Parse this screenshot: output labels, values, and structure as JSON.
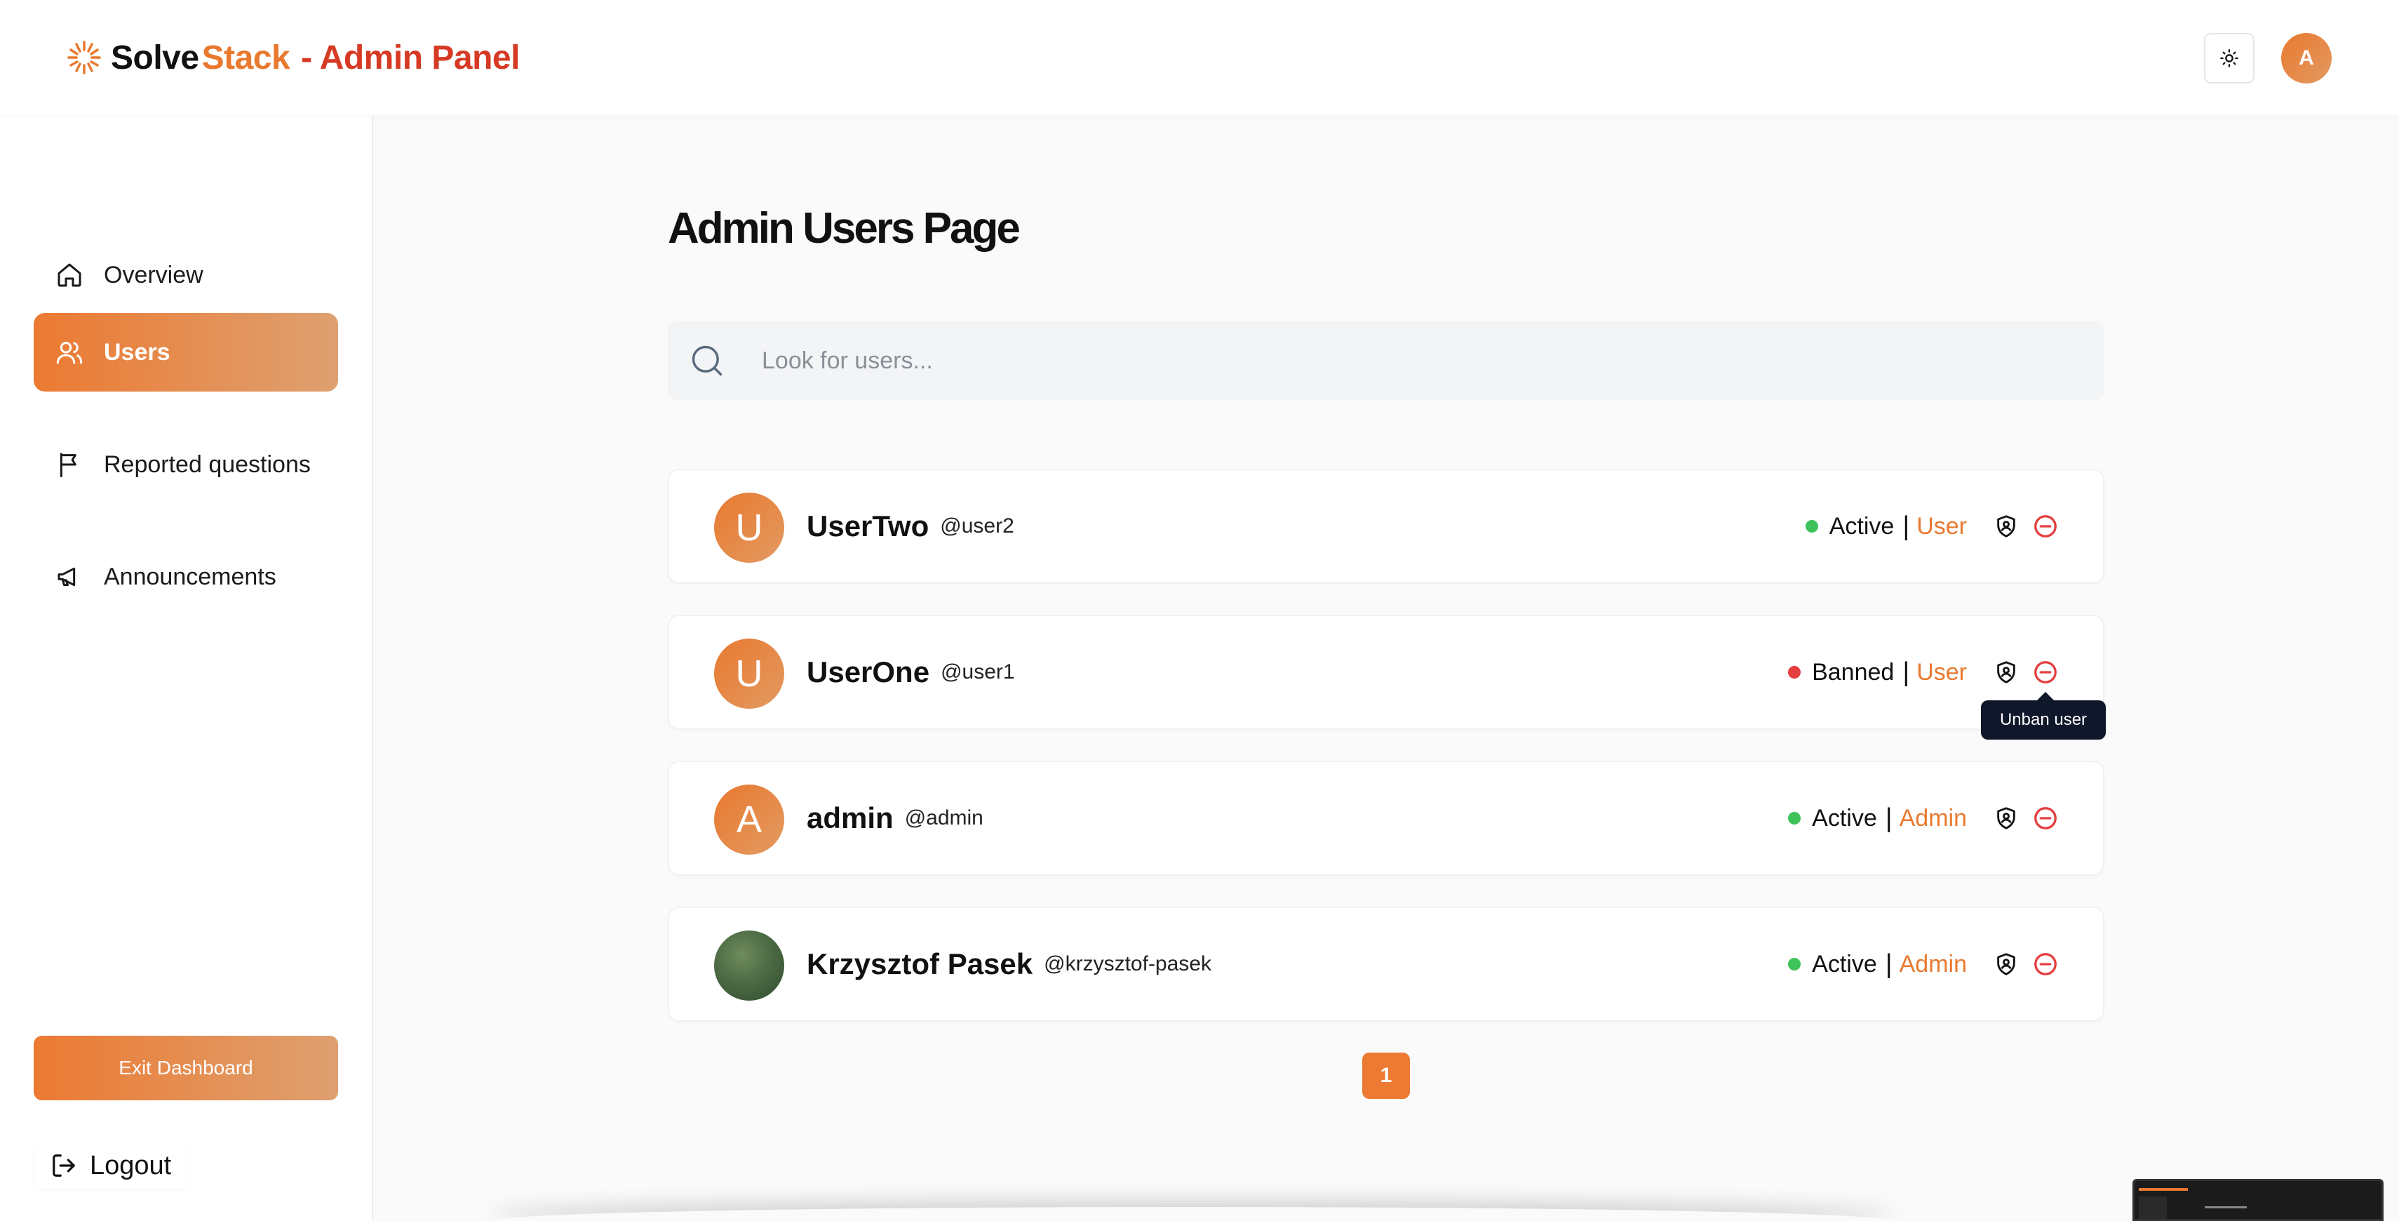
{
  "header": {
    "brand_solve": "Solve",
    "brand_stack": "Stack",
    "brand_admin": "- Admin Panel",
    "avatar_initial": "A",
    "theme_icon": "sun-icon"
  },
  "sidebar": {
    "items": [
      {
        "label": "Overview",
        "icon": "home-icon",
        "active": false
      },
      {
        "label": "Users",
        "icon": "users-icon",
        "active": true
      },
      {
        "label": "Reported questions",
        "icon": "flag-icon",
        "active": false
      },
      {
        "label": "Announcements",
        "icon": "megaphone-icon",
        "active": false
      }
    ],
    "exit_label": "Exit Dashboard",
    "logout_label": "Logout"
  },
  "main": {
    "title": "Admin Users Page",
    "search": {
      "placeholder": "Look for users...",
      "value": ""
    },
    "users": [
      {
        "initial": "U",
        "name": "UserTwo",
        "handle": "@user2",
        "status": "Active",
        "status_color": "#3ec25a",
        "role": "User"
      },
      {
        "initial": "U",
        "name": "UserOne",
        "handle": "@user1",
        "status": "Banned",
        "status_color": "#e53e3e",
        "role": "User"
      },
      {
        "initial": "A",
        "name": "admin",
        "handle": "@admin",
        "status": "Active",
        "status_color": "#3ec25a",
        "role": "Admin"
      },
      {
        "initial": "",
        "name": "Krzysztof Pasek",
        "handle": "@krzysztof-pasek",
        "status": "Active",
        "status_color": "#3ec25a",
        "role": "Admin"
      }
    ],
    "separator": "|",
    "tooltip": "Unban user",
    "page": "1"
  },
  "colors": {
    "accent": "#e8792f",
    "brand_admin": "#d63a24",
    "danger": "#e53e3e",
    "success": "#3ec25a"
  }
}
